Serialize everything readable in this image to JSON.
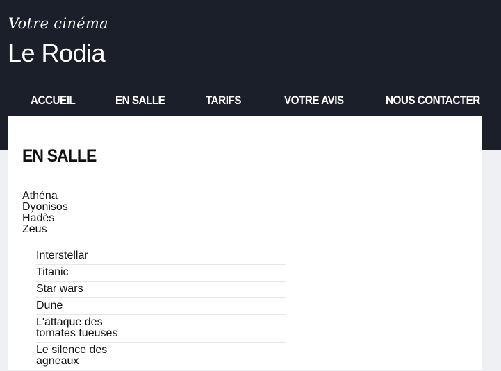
{
  "header": {
    "tagline": "Votre cinéma",
    "site_title": "Le Rodia"
  },
  "nav": {
    "items": [
      {
        "label": "ACCUEIL"
      },
      {
        "label": "EN SALLE"
      },
      {
        "label": "TARIFS"
      },
      {
        "label": "VOTRE AVIS"
      },
      {
        "label": "NOUS CONTACTER"
      }
    ]
  },
  "main": {
    "heading": "EN SALLE",
    "rooms": [
      "Athéna",
      "Dyonisos",
      "Hadès",
      "Zeus"
    ],
    "films": [
      "Interstellar",
      "Titanic",
      "Star wars",
      "Dune",
      "L'attaque des tomates tueuses",
      "Le silence des agneaux"
    ]
  }
}
